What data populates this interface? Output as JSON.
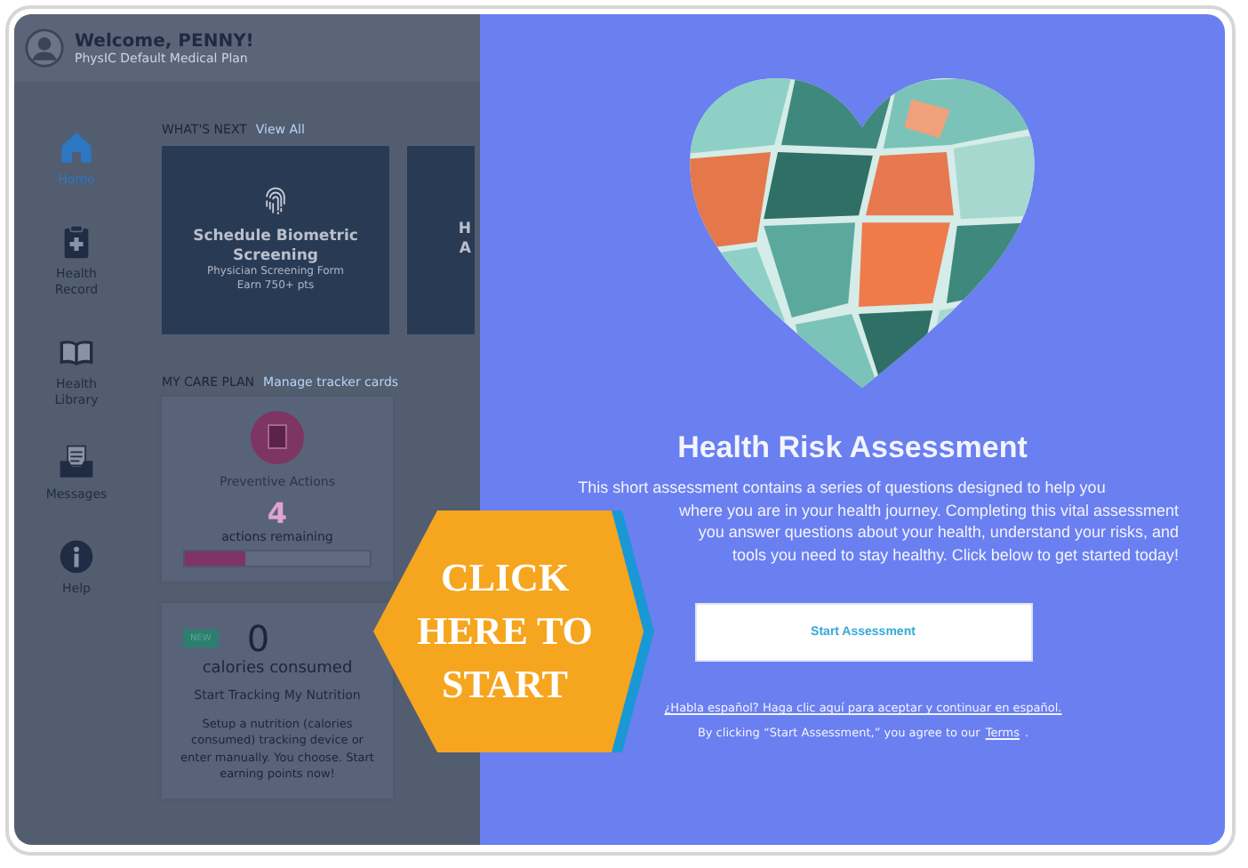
{
  "header": {
    "greeting": "Welcome, PENNY!",
    "plan": "PhysIC Default Medical Plan"
  },
  "sidebar": {
    "items": [
      {
        "label": "Home",
        "selected": true
      },
      {
        "label": "Health Record",
        "selected": false
      },
      {
        "label": "Health Library",
        "selected": false
      },
      {
        "label": "Messages",
        "selected": false
      },
      {
        "label": "Help",
        "selected": false
      }
    ]
  },
  "whats_next": {
    "heading": "WHAT'S NEXT",
    "link": "View All",
    "cards": [
      {
        "title_lines": [
          "Schedule Biometric",
          "Screening"
        ],
        "subtitle": "Physician Screening Form",
        "points": "Earn 750+ pts"
      },
      {
        "title_lines": [
          "H",
          "A"
        ]
      }
    ]
  },
  "care_plan": {
    "heading": "MY CARE PLAN",
    "link": "Manage tracker cards",
    "cards": [
      {
        "kind": "progress",
        "title": "Preventive Actions",
        "count": "4",
        "caption": "actions remaining",
        "level": 0.33
      },
      {
        "kind": "tracker",
        "badge": "NEW",
        "count": "0",
        "caption": "calories consumed",
        "title": "Start Tracking My Nutrition",
        "description": "Setup a nutrition (calories consumed) tracking device or enter manually. You choose. Start earning points now!"
      }
    ]
  },
  "assessment": {
    "title": "Health Risk Assessment",
    "paragraph_lines": [
      "This short assessment contains a series of questions designed to help you",
      "where you are in your health journey. Completing this vital assessment",
      "you answer questions about your health, understand your risks, and",
      "tools you need to stay healthy. Click below to get started today!"
    ],
    "button": "Start Assessment",
    "spanish_link": "¿Habla español? Haga clic aquí para aceptar y continuar en español.",
    "consent": "By clicking “Start Assessment,” you agree to our",
    "terms_link": "Terms",
    "consent_end": "."
  },
  "callout": {
    "text": "CLICK HERE TO START"
  }
}
